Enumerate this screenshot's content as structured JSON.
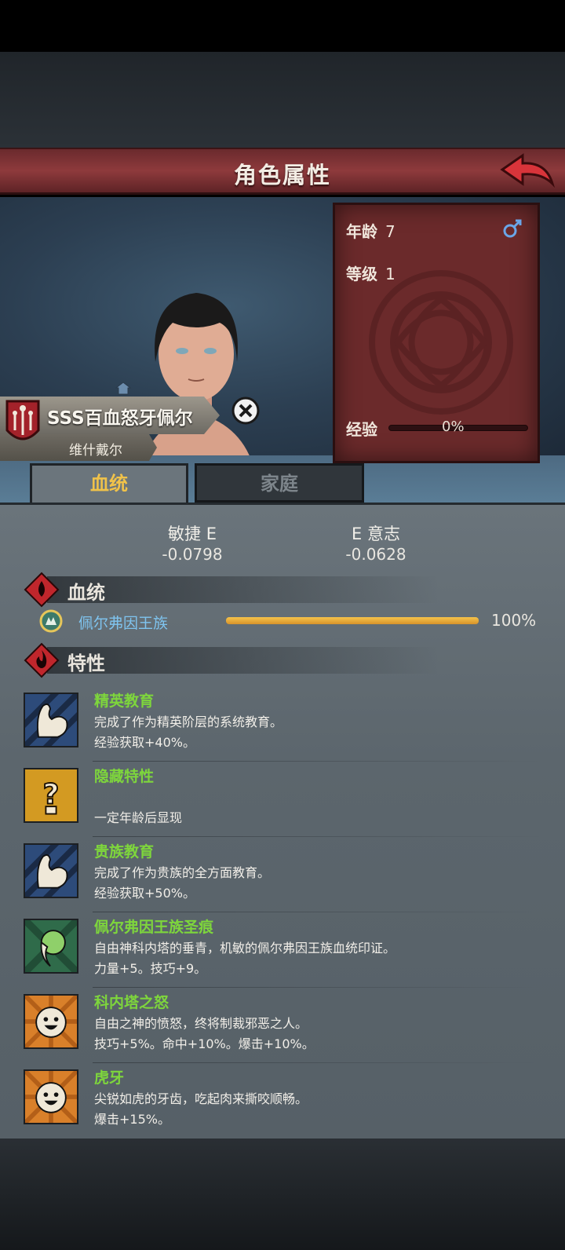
{
  "header": {
    "title": "角色属性"
  },
  "stats": {
    "age_label": "年龄",
    "age_value": "7",
    "level_label": "等级",
    "level_value": "1",
    "exp_label": "经验",
    "exp_value": "0%"
  },
  "character": {
    "name": "SSS百血怒牙佩尔",
    "subtitle": "维什戴尔"
  },
  "tabs": [
    {
      "label": "血统"
    },
    {
      "label": "家庭"
    }
  ],
  "attributes": [
    {
      "label": "敏捷  E",
      "value": "-0.0798"
    },
    {
      "label": "E  意志",
      "value": "-0.0628"
    }
  ],
  "sections": {
    "lineage": "血统",
    "traits": "特性"
  },
  "lineage": {
    "name": "佩尔弗因王族",
    "percent_text": "100%",
    "fill": 1.0
  },
  "traits": [
    {
      "name": "精英教育",
      "desc": "完成了作为精英阶层的系统教育。",
      "effect": "经验获取+40%。"
    },
    {
      "name": "隐藏特性",
      "desc": "",
      "effect": "一定年龄后显现"
    },
    {
      "name": "贵族教育",
      "desc": "完成了作为贵族的全方面教育。",
      "effect": "经验获取+50%。"
    },
    {
      "name": "佩尔弗因王族圣痕",
      "desc": "自由神科内塔的垂青，机敏的佩尔弗因王族血统印证。",
      "effect": "力量+5。技巧+9。"
    },
    {
      "name": "科内塔之怒",
      "desc": "自由之神的愤怒，终将制裁邪恶之人。",
      "effect": "技巧+5%。命中+10%。爆击+10%。"
    },
    {
      "name": "虎牙",
      "desc": "尖锐如虎的牙齿，吃起肉来撕咬顺畅。",
      "effect": "爆击+15%。"
    }
  ],
  "colors": {
    "accent_red": "#8e3a3c",
    "trait_name": "#7ed63c",
    "lineage_name": "#7fc4ef",
    "tab_active": "#f0c24a"
  }
}
